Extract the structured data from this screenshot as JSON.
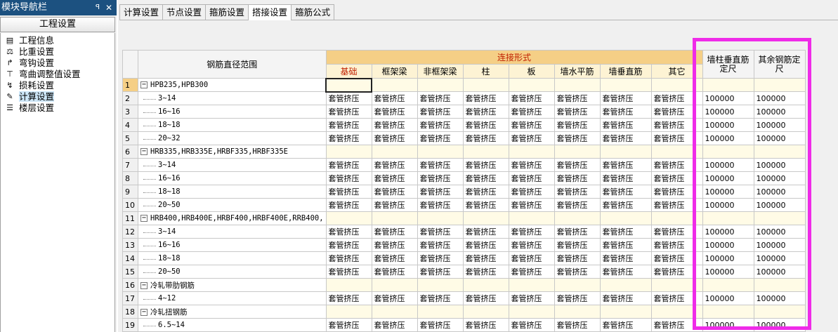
{
  "nav": {
    "title": "模块导航栏",
    "pin": "ꟼ",
    "close": "✕",
    "header": "工程设置",
    "items": [
      {
        "label": "工程信息",
        "icon": "project-info-icon",
        "glyph": "▤"
      },
      {
        "label": "比重设置",
        "icon": "weight-icon",
        "glyph": "⚖"
      },
      {
        "label": "弯钩设置",
        "icon": "hook-icon",
        "glyph": "↱"
      },
      {
        "label": "弯曲调整值设置",
        "icon": "bend-icon",
        "glyph": "⊤"
      },
      {
        "label": "损耗设置",
        "icon": "loss-icon",
        "glyph": "↯"
      },
      {
        "label": "计算设置",
        "icon": "calc-icon",
        "glyph": "✎"
      },
      {
        "label": "楼层设置",
        "icon": "floor-icon",
        "glyph": "☰"
      }
    ]
  },
  "tabs": [
    "计算设置",
    "节点设置",
    "箍筋设置",
    "搭接设置",
    "箍筋公式"
  ],
  "active_tab": 3,
  "grid": {
    "header_range": "钢筋直径范围",
    "header_conn": "连接形式",
    "header_wall_v": "墙柱垂直筋定尺",
    "header_other": "其余钢筋定尺",
    "sub_headers": [
      "基础",
      "框架梁",
      "非框架梁",
      "柱",
      "板",
      "墙水平筋",
      "墙垂直筋",
      "其它"
    ],
    "rows": [
      {
        "n": "1",
        "name": "HPB235,HPB300",
        "group": true
      },
      {
        "n": "2",
        "name": "3~14",
        "c": "套管挤压",
        "v1": "100000",
        "v2": "100000"
      },
      {
        "n": "3",
        "name": "16~16",
        "c": "套管挤压",
        "v1": "100000",
        "v2": "100000"
      },
      {
        "n": "4",
        "name": "18~18",
        "c": "套管挤压",
        "v1": "100000",
        "v2": "100000"
      },
      {
        "n": "5",
        "name": "20~32",
        "c": "套管挤压",
        "v1": "100000",
        "v2": "100000"
      },
      {
        "n": "6",
        "name": "HRB335,HRB335E,HRBF335,HRBF335E",
        "group": true
      },
      {
        "n": "7",
        "name": "3~14",
        "c": "套管挤压",
        "v1": "100000",
        "v2": "100000"
      },
      {
        "n": "8",
        "name": "16~16",
        "c": "套管挤压",
        "v1": "100000",
        "v2": "100000"
      },
      {
        "n": "9",
        "name": "18~18",
        "c": "套管挤压",
        "v1": "100000",
        "v2": "100000"
      },
      {
        "n": "10",
        "name": "20~50",
        "c": "套管挤压",
        "v1": "100000",
        "v2": "100000"
      },
      {
        "n": "11",
        "name": "HRB400,HRB400E,HRBF400,HRBF400E,RRB400,",
        "group": true
      },
      {
        "n": "12",
        "name": "3~14",
        "c": "套管挤压",
        "v1": "100000",
        "v2": "100000"
      },
      {
        "n": "13",
        "name": "16~16",
        "c": "套管挤压",
        "v1": "100000",
        "v2": "100000"
      },
      {
        "n": "14",
        "name": "18~18",
        "c": "套管挤压",
        "v1": "100000",
        "v2": "100000"
      },
      {
        "n": "15",
        "name": "20~50",
        "c": "套管挤压",
        "v1": "100000",
        "v2": "100000"
      },
      {
        "n": "16",
        "name": "冷轧带肋钢筋",
        "group": true
      },
      {
        "n": "17",
        "name": "4~12",
        "c": "套管挤压",
        "v1": "100000",
        "v2": "100000"
      },
      {
        "n": "18",
        "name": "冷轧扭钢筋",
        "group": true
      },
      {
        "n": "19",
        "name": "6.5~14",
        "c": "套管挤压",
        "v1": "100000",
        "v2": "100000"
      }
    ]
  },
  "colors": {
    "highlight": "#ef2be8",
    "conn_header": "#f5cf86",
    "title_bar": "#1c5180"
  }
}
